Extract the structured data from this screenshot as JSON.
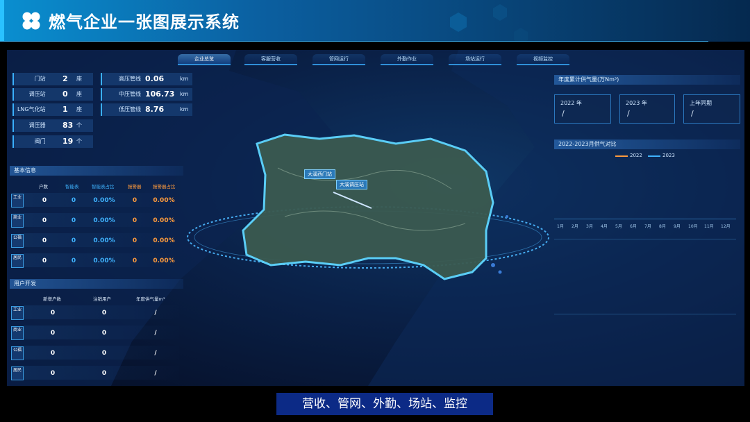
{
  "header": {
    "title": "燃气企业一张图展示系统"
  },
  "nav": {
    "tabs": [
      "企业总览",
      "客服营收",
      "管网运行",
      "外勤作业",
      "场站运行",
      "视频监控"
    ]
  },
  "stats_left": [
    {
      "label": "门站",
      "value": "2",
      "unit": "座"
    },
    {
      "label": "调压站",
      "value": "0",
      "unit": "座"
    },
    {
      "label": "LNG气化站",
      "value": "1",
      "unit": "座"
    },
    {
      "label": "调压器",
      "value": "83",
      "unit": "个"
    },
    {
      "label": "阀门",
      "value": "19",
      "unit": "个"
    }
  ],
  "stats_right": [
    {
      "label": "高压管线",
      "value": "0.06",
      "unit": "km"
    },
    {
      "label": "中压管线",
      "value": "106.73",
      "unit": "km"
    },
    {
      "label": "低压管线",
      "value": "8.76",
      "unit": "km"
    }
  ],
  "basic_info": {
    "title": "基本信息",
    "headers": [
      "户数",
      "智能表",
      "智能表占比",
      "报警器",
      "报警器占比"
    ],
    "rows": [
      {
        "label": "工业",
        "values": [
          "0",
          "0",
          "0.00%",
          "0",
          "0.00%"
        ]
      },
      {
        "label": "商业",
        "values": [
          "0",
          "0",
          "0.00%",
          "0",
          "0.00%"
        ]
      },
      {
        "label": "公福",
        "values": [
          "0",
          "0",
          "0.00%",
          "0",
          "0.00%"
        ]
      },
      {
        "label": "居民",
        "values": [
          "0",
          "0",
          "0.00%",
          "0",
          "0.00%"
        ]
      }
    ]
  },
  "user_dev": {
    "title": "用户开发",
    "headers": [
      "新增户数",
      "注销用户",
      "年度供气量m³"
    ],
    "rows": [
      {
        "label": "工业",
        "values": [
          "0",
          "0",
          "/"
        ]
      },
      {
        "label": "商业",
        "values": [
          "0",
          "0",
          "/"
        ]
      },
      {
        "label": "公福",
        "values": [
          "0",
          "0",
          "/"
        ]
      },
      {
        "label": "居民",
        "values": [
          "0",
          "0",
          "/"
        ]
      }
    ]
  },
  "map": {
    "labels": [
      "大溪西门站",
      "大溪调压站"
    ],
    "colors": {
      "land": "#3b5a50",
      "glow": "#5fd6ff",
      "ring": "#4bb8ff"
    }
  },
  "right_panel": {
    "supply_title": "年度累计供气量(万Nm³)",
    "cards": [
      {
        "label": "2022 年",
        "value": "/"
      },
      {
        "label": "2023 年",
        "value": "/"
      },
      {
        "label": "上年同期",
        "value": "/"
      }
    ],
    "compare_title": "2022-2023月供气对比",
    "legend": [
      {
        "name": "2022",
        "color": "#ff9b3d"
      },
      {
        "name": "2023",
        "color": "#3fb3ff"
      }
    ],
    "months": [
      "1月",
      "2月",
      "3月",
      "4月",
      "5月",
      "6月",
      "7月",
      "8月",
      "9月",
      "10月",
      "11月",
      "12月"
    ]
  },
  "caption": "营收、管网、外勤、场站、监控"
}
